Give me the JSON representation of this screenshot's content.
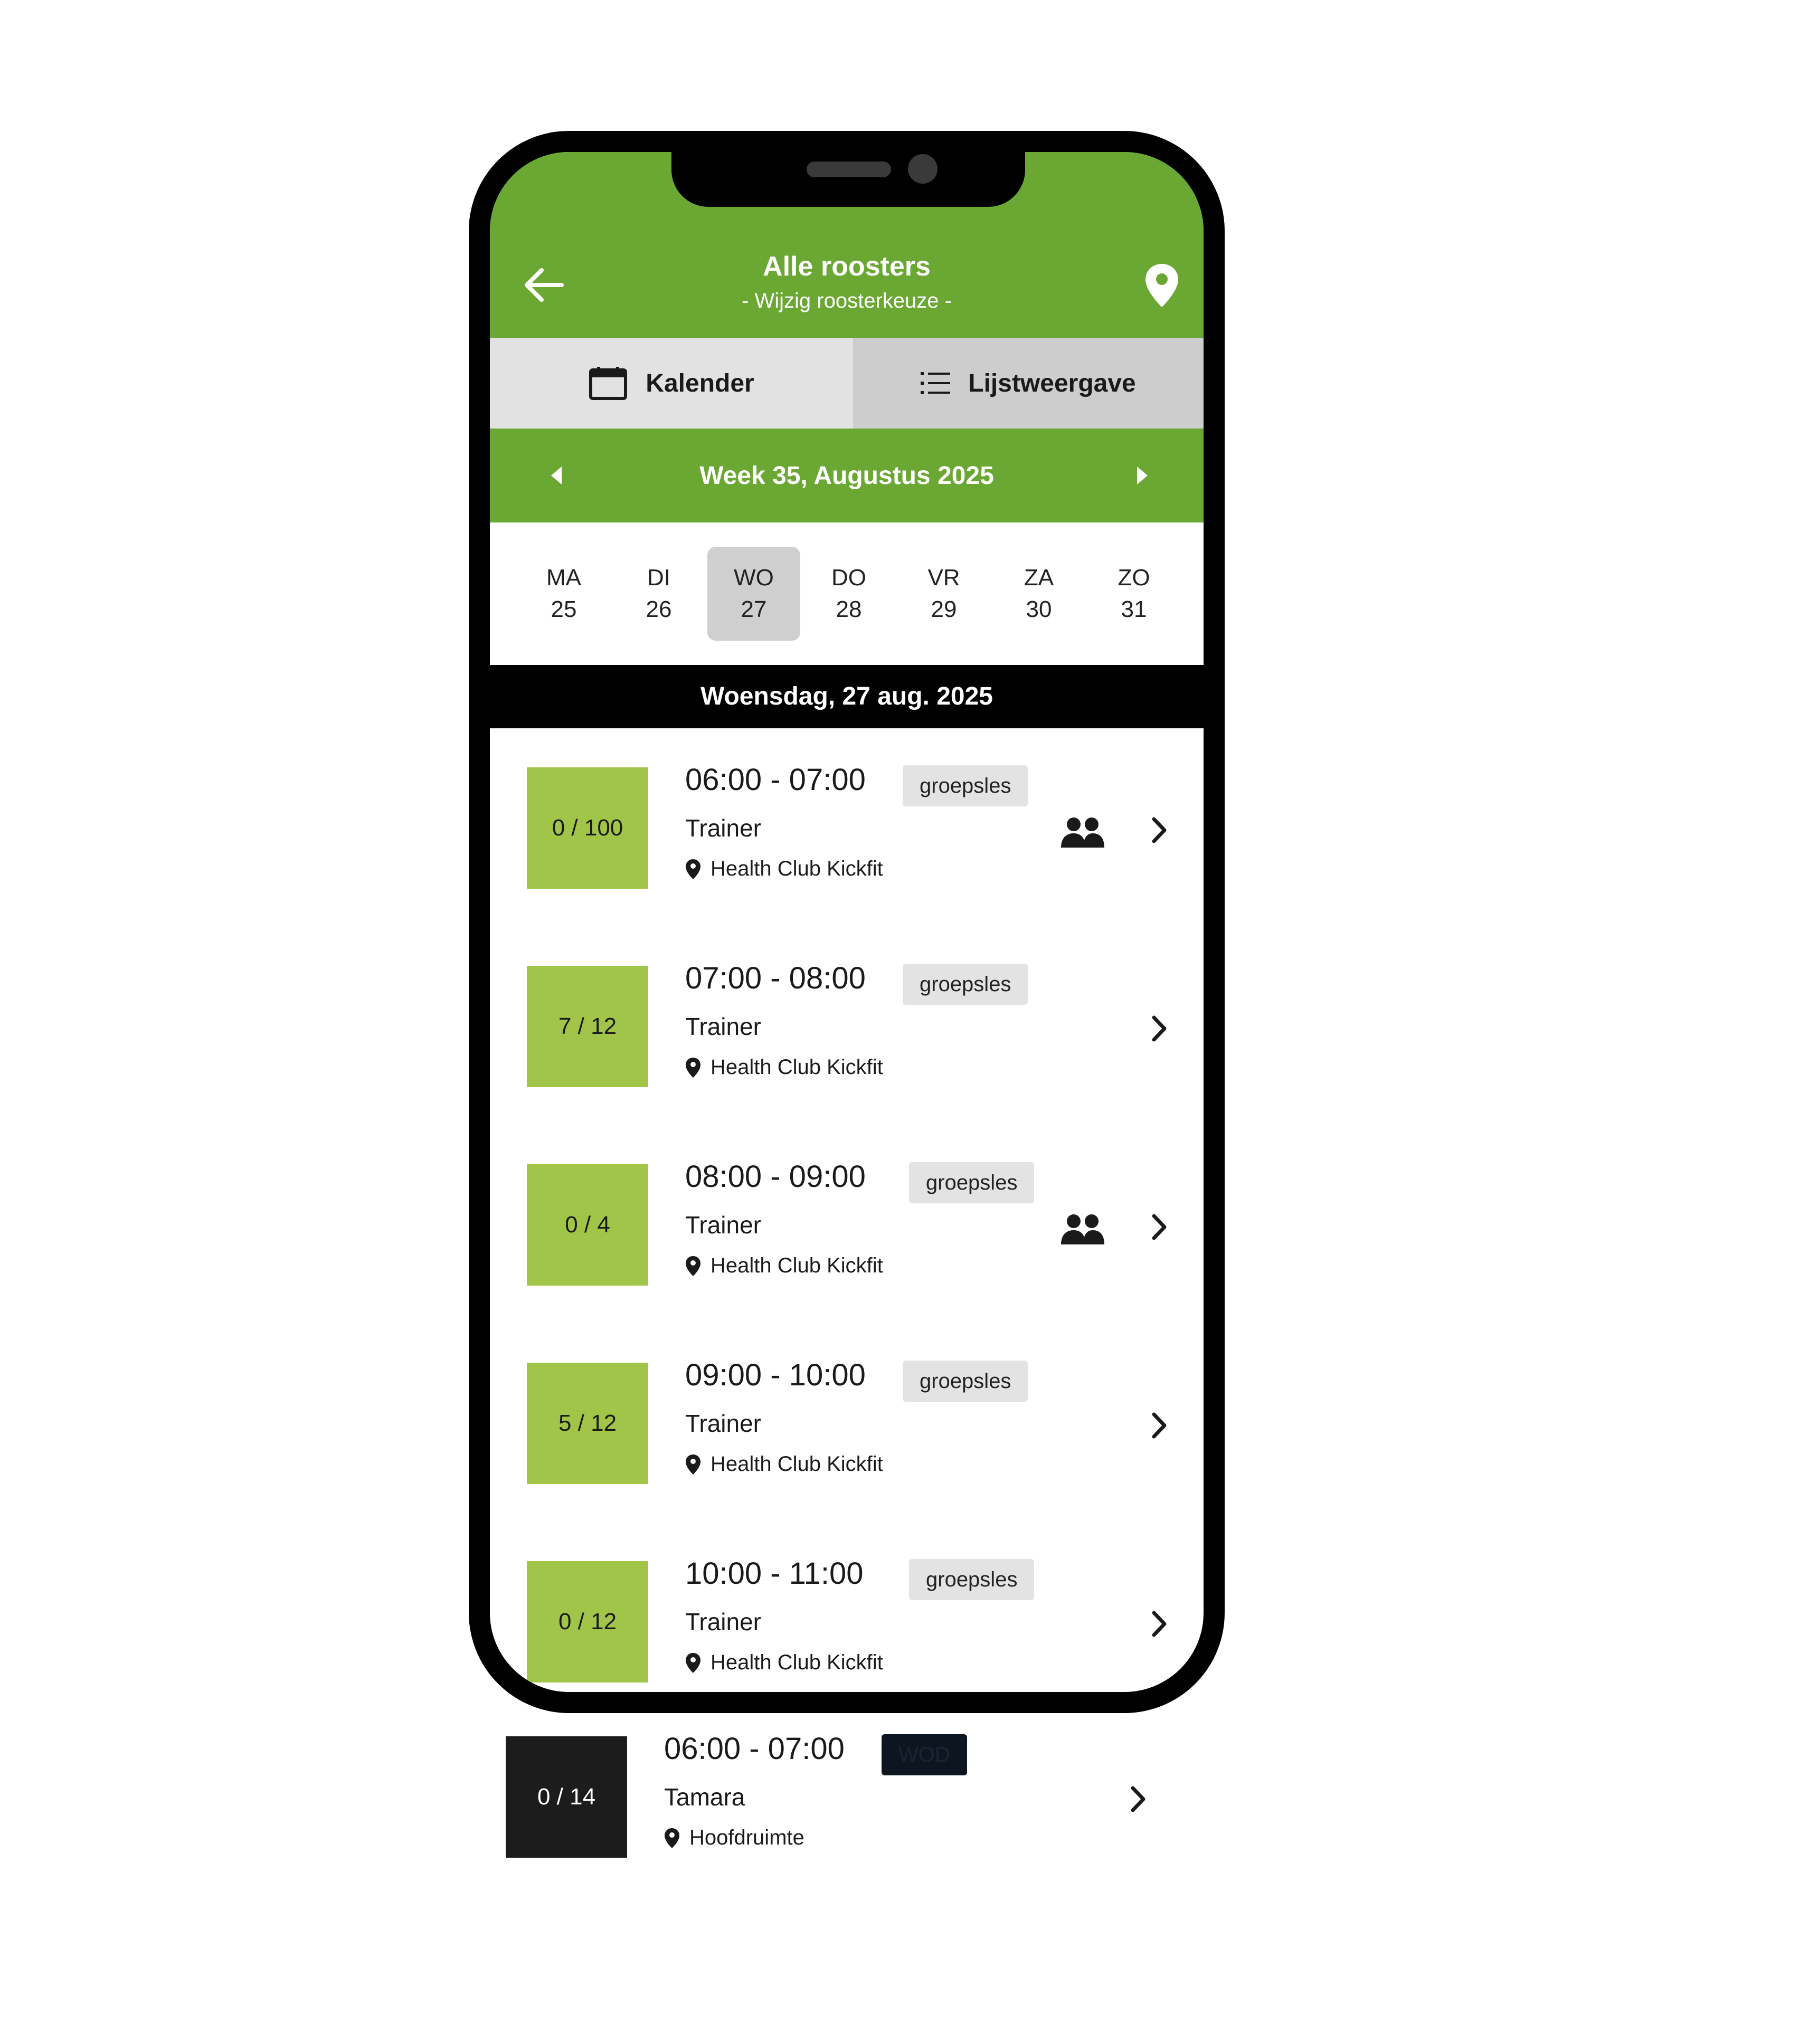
{
  "header": {
    "title": "Alle roosters",
    "subtitle": "- Wijzig roosterkeuze -"
  },
  "tabs": {
    "calendar_label": "Kalender",
    "list_label": "Lijstweergave"
  },
  "week": {
    "label": "Week 35, Augustus 2025"
  },
  "days": [
    {
      "name": "MA",
      "date": "25"
    },
    {
      "name": "DI",
      "date": "26"
    },
    {
      "name": "WO",
      "date": "27"
    },
    {
      "name": "DO",
      "date": "28"
    },
    {
      "name": "VR",
      "date": "29"
    },
    {
      "name": "ZA",
      "date": "30"
    },
    {
      "name": "ZO",
      "date": "31"
    }
  ],
  "selected_date_label": "Woensdag, 27 aug. 2025",
  "sessions": [
    {
      "capacity": "0 / 100",
      "time": "06:00 - 07:00",
      "type": "groepsles",
      "trainer": "Trainer",
      "location": "Health Club Kickfit"
    },
    {
      "capacity": "7 / 12",
      "time": "07:00 - 08:00",
      "type": "groepsles",
      "trainer": "Trainer",
      "location": "Health Club Kickfit"
    },
    {
      "capacity": "0 / 4",
      "time": "08:00 - 09:00",
      "type": "groepsles",
      "trainer": "Trainer",
      "location": "Health Club Kickfit"
    },
    {
      "capacity": "5 / 12",
      "time": "09:00 - 10:00",
      "type": "groepsles",
      "trainer": "Trainer",
      "location": "Health Club Kickfit"
    },
    {
      "capacity": "0 / 12",
      "time": "10:00 - 11:00",
      "type": "groepsles",
      "trainer": "Trainer",
      "location": "Health Club Kickfit"
    }
  ],
  "extra_session": {
    "capacity": "0 / 14",
    "time": "06:00 - 07:00",
    "type": "WOD",
    "trainer": "Tamara",
    "location": "Hoofdruimte"
  },
  "colors": {
    "brand_green": "#6aa833",
    "capacity_green": "#a1c548",
    "tab_active": "#e2e2e2",
    "tab_inactive": "#cdcdcd"
  }
}
